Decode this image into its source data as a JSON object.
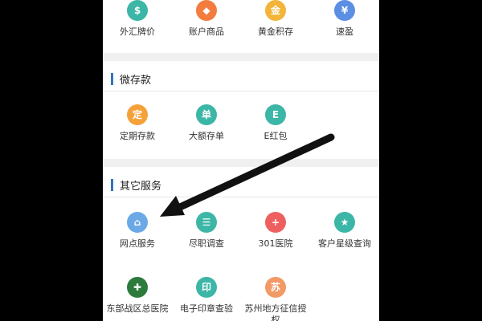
{
  "colors": {
    "accent": "#2f74c2",
    "orange": "#f5a13a",
    "orange_red": "#f37c3e",
    "gold": "#f3b43a",
    "blue": "#5b8fe3",
    "teal": "#3cb6a6",
    "red": "#ee6060",
    "dark_green": "#2c7a3c",
    "light_blue": "#6aa9e6",
    "salmon": "#f29a66"
  },
  "top_row": [
    {
      "label": "外汇牌价",
      "icon": "exchange-rate-icon",
      "glyph": "$"
    },
    {
      "label": "账户商品",
      "icon": "gift-icon",
      "glyph": "◆"
    },
    {
      "label": "黄金积存",
      "icon": "gold-icon",
      "glyph": "金"
    },
    {
      "label": "速盈",
      "icon": "quick-profit-icon",
      "glyph": "¥"
    }
  ],
  "micro_deposit": {
    "title": "微存款",
    "items": [
      {
        "label": "定期存款",
        "icon": "fixed-deposit-icon",
        "glyph": "定"
      },
      {
        "label": "大额存单",
        "icon": "large-deposit-icon",
        "glyph": "单"
      },
      {
        "label": "E红包",
        "icon": "red-packet-icon",
        "glyph": "E"
      }
    ]
  },
  "other_services": {
    "title": "其它服务",
    "row1": [
      {
        "label": "网点服务",
        "icon": "branch-icon",
        "glyph": "⌂"
      },
      {
        "label": "尽职调查",
        "icon": "survey-icon",
        "glyph": "☰"
      },
      {
        "label": "301医院",
        "icon": "hospital-icon",
        "glyph": "+"
      },
      {
        "label": "客户星级查询",
        "icon": "star-query-icon",
        "glyph": "★"
      }
    ],
    "row2": [
      {
        "label": "东部战区总医院",
        "icon": "east-hospital-icon",
        "glyph": "✚"
      },
      {
        "label": "电子印章查验",
        "icon": "seal-check-icon",
        "glyph": "印"
      },
      {
        "label": "苏州地方征信授权",
        "icon": "credit-auth-icon",
        "glyph": "苏"
      }
    ]
  }
}
